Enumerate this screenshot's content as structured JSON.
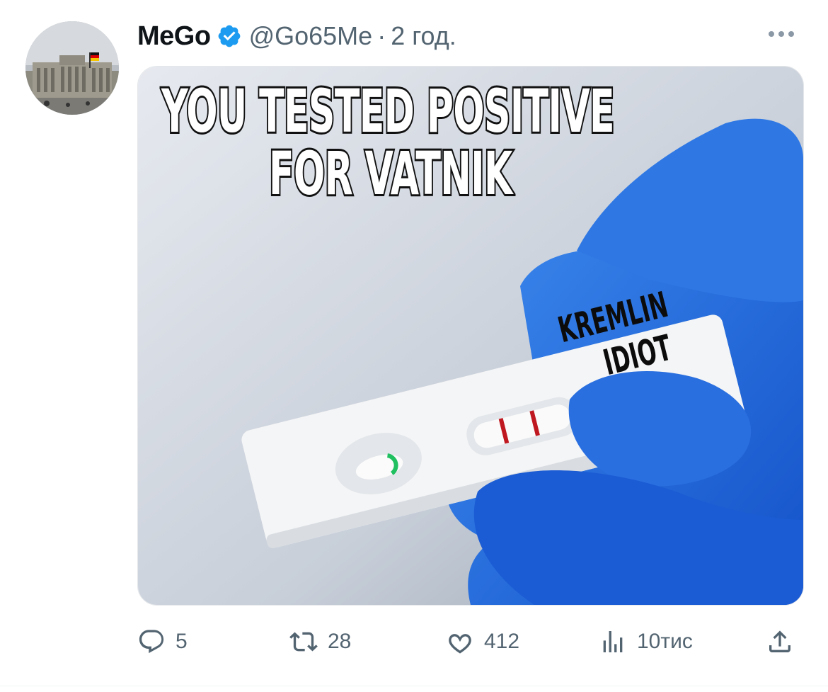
{
  "tweet": {
    "author_name": "MeGo",
    "handle": "@Go65Me",
    "separator": "·",
    "time": "2 год.",
    "verified_color": "#1d9bf0"
  },
  "media": {
    "headline_line1": "YOU TESTED POSITIVE",
    "headline_line2": "FOR VATNIK",
    "strip_line1": "KREMLIN",
    "strip_line2": "IDIOT"
  },
  "actions": {
    "replies": "5",
    "retweets": "28",
    "likes": "412",
    "views": "10тис"
  },
  "icons": {
    "reply": "speech-bubble-icon",
    "retweet": "retweet-arrows-icon",
    "like": "heart-icon",
    "views": "bar-chart-icon",
    "share": "upload-icon",
    "more": "ellipsis-icon",
    "verified": "verified-badge-icon"
  }
}
